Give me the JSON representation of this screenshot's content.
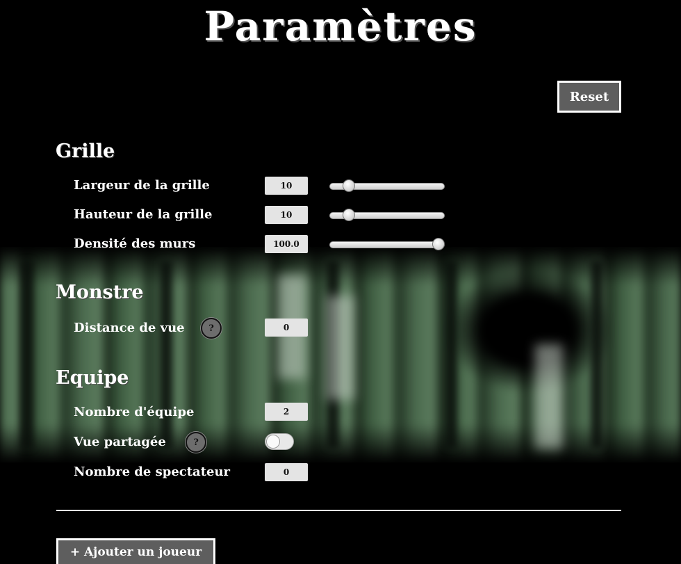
{
  "page": {
    "title": "Paramètres"
  },
  "toolbar": {
    "reset_label": "Reset"
  },
  "sections": {
    "grille": {
      "title": "Grille",
      "largeur": {
        "label": "Largeur de la grille",
        "value": "10",
        "slider_fraction": 0.13
      },
      "hauteur": {
        "label": "Hauteur de la grille",
        "value": "10",
        "slider_fraction": 0.13
      },
      "densite": {
        "label": "Densité des murs",
        "value": "100.0",
        "slider_fraction": 1.0
      }
    },
    "monstre": {
      "title": "Monstre",
      "distance": {
        "label": "Distance de vue",
        "help": "?",
        "value": "0"
      }
    },
    "equipe": {
      "title": "Equipe",
      "nombre_equipe": {
        "label": "Nombre d'équipe",
        "value": "2"
      },
      "vue_partagee": {
        "label": "Vue partagée",
        "help": "?",
        "enabled": false
      },
      "spectateurs": {
        "label": "Nombre de spectateur",
        "value": "0"
      }
    }
  },
  "footer": {
    "add_player_label": "+ Ajouter un joueur"
  }
}
